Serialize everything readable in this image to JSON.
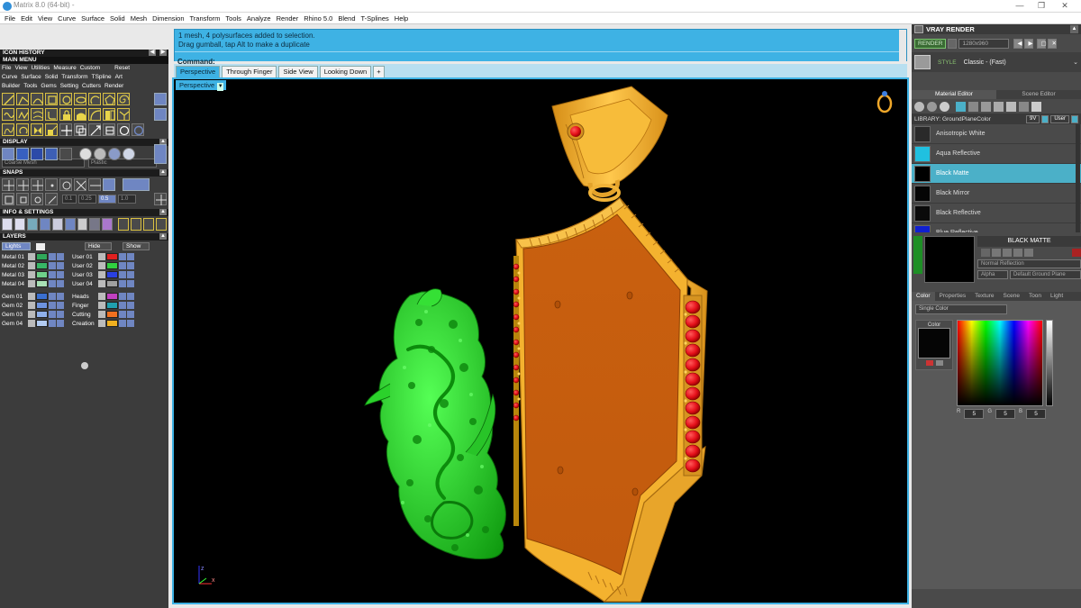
{
  "window": {
    "title": "Matrix 8.0 (64-bit) -",
    "controls": [
      "—",
      "❐",
      "✕"
    ]
  },
  "menu": [
    "File",
    "Edit",
    "View",
    "Curve",
    "Surface",
    "Solid",
    "Mesh",
    "Dimension",
    "Transform",
    "Tools",
    "Analyze",
    "Render",
    "Rhino 5.0",
    "Blend",
    "T-Splines",
    "Help"
  ],
  "left": {
    "icon_history": "ICON HISTORY",
    "main_menu": "MAIN MENU",
    "menu_row1": [
      "File",
      "View",
      "Utilities",
      "Measure",
      "Custom",
      "Reset"
    ],
    "menu_row2": [
      "Curve",
      "Surface",
      "Solid",
      "Transform",
      "TSpline",
      "Art"
    ],
    "menu_row3": [
      "Builder",
      "Tools",
      "Gems",
      "Setting",
      "Cutters",
      "Render"
    ],
    "display": "DISPLAY",
    "display_mesh": "Coarse Mesh",
    "display_material": "Plastic",
    "snaps": "SNAPS",
    "snap_values": [
      "0.1",
      "0.25",
      "0.5",
      "1.0"
    ],
    "info_settings": "INFO & SETTINGS",
    "layers": "LAYERS",
    "layer_buttons": [
      "Lights",
      "Hide",
      "Show"
    ],
    "layers_left": [
      {
        "name": "Metal 01",
        "color": "#2fa85a"
      },
      {
        "name": "Metal 02",
        "color": "#37b766"
      },
      {
        "name": "Metal 03",
        "color": "#6fd08a"
      },
      {
        "name": "Metal 04",
        "color": "#a8e0b5"
      },
      {
        "name": "Gem 01",
        "color": "#3a6fd0"
      },
      {
        "name": "Gem 02",
        "color": "#6d93e0"
      },
      {
        "name": "Gem 03",
        "color": "#8fb0ea"
      },
      {
        "name": "Gem 04",
        "color": "#b2cbf2"
      }
    ],
    "layers_right": [
      {
        "name": "User 01",
        "color": "#e02020"
      },
      {
        "name": "User 02",
        "color": "#30d040"
      },
      {
        "name": "User 03",
        "color": "#2a40e0"
      },
      {
        "name": "User 04",
        "color": "#a0a0a0"
      },
      {
        "name": "Heads",
        "color": "#c040c0"
      },
      {
        "name": "Finger",
        "color": "#20a0b0"
      },
      {
        "name": "Cutting",
        "color": "#f07020"
      },
      {
        "name": "Creation",
        "color": "#f0b020"
      }
    ]
  },
  "command": {
    "history": [
      "1 mesh, 4 polysurfaces added to selection.",
      "Drag gumball, tap Alt to make a duplicate"
    ],
    "label": "Command:"
  },
  "viewport": {
    "tabs": [
      "Perspective",
      "Through Finger",
      "Side View",
      "Looking Down",
      "+"
    ],
    "active_tab": "Perspective",
    "label": "Perspective",
    "axis_z": "z",
    "axis_x": "x"
  },
  "right": {
    "title": "VRAY RENDER",
    "render_button": "RENDER",
    "resolution": "1280x960",
    "style_label": "STYLE",
    "style_value": "Classic - (Fast)",
    "tabs": [
      "Material Editor",
      "Scene Editor"
    ],
    "library_label": "LIBRARY: GroundPlaneColor",
    "library_buttons": [
      "9V",
      "User"
    ],
    "materials": [
      {
        "name": "Anisotropic White",
        "color": "#2a2a2a"
      },
      {
        "name": "Aqua Reflective",
        "color": "#20c0e0"
      },
      {
        "name": "Black Matte",
        "color": "#000000"
      },
      {
        "name": "Black Mirror",
        "color": "#050505"
      },
      {
        "name": "Black Reflective",
        "color": "#0a0a0a"
      },
      {
        "name": "Blue Reflective",
        "color": "#1020d0"
      }
    ],
    "selected_material": "BLACK MATTE",
    "reflection": "Normal Reflection",
    "alpha": "Alpha",
    "ground_plane": "Default Ground Plane",
    "prop_tabs": [
      "Color",
      "Properties",
      "Texture",
      "Scene",
      "Toon",
      "Light"
    ],
    "color_mode": "Single Color",
    "color_label": "Color",
    "rgb": [
      "5",
      "5",
      "5"
    ]
  },
  "colors": {
    "accent": "#3eb2e4",
    "dragon": "#22cc22",
    "pendant_gold": "#f5b733",
    "pendant_face": "#cc5f10",
    "ruby": "#e8121a"
  }
}
